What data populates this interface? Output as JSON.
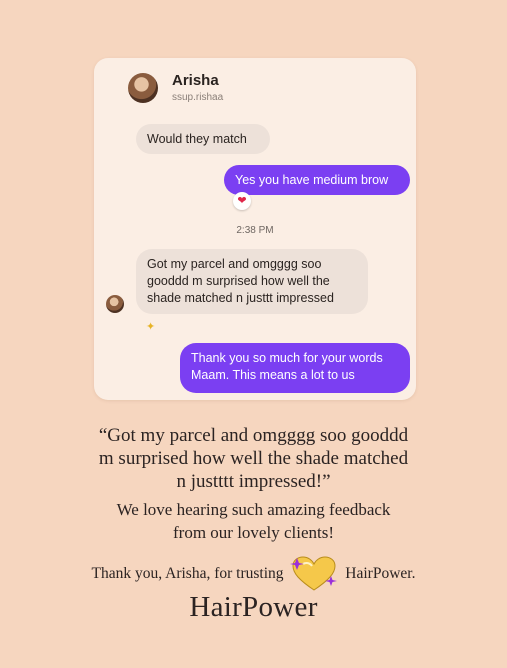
{
  "chat": {
    "contact_name": "Arisha",
    "contact_handle": "ssup.rishaa",
    "timestamp": "2:38 PM",
    "messages": [
      {
        "direction": "incoming",
        "text": "Would they match"
      },
      {
        "direction": "outgoing",
        "text": "Yes you have medium brow",
        "reaction": "heart"
      },
      {
        "direction": "incoming",
        "lines": [
          "Got my parcel and omgggg soo",
          "gooddd m surprised how well the",
          "shade matched n justtt impressed"
        ]
      },
      {
        "direction": "outgoing",
        "lines": [
          "Thank you so much for your words",
          "Maam. This means a lot to us"
        ]
      }
    ]
  },
  "caption": {
    "quote_lines": [
      "“Got my parcel and omgggg soo gooddd",
      "m surprised how well the shade matched",
      "n justttt impressed!”"
    ],
    "body_lines": [
      "We love hearing such amazing feedback",
      "from our lovely clients!"
    ],
    "thanks_before": "Thank you, Arisha, for trusting",
    "thanks_after": "HairPower.",
    "brand": "HairPower"
  },
  "colors": {
    "background": "#f6d6bf",
    "outgoing_bubble": "#7b3ff2",
    "incoming_bubble": "#ede1d9",
    "text": "#2b2322"
  },
  "icons": {
    "reaction": "heart-icon",
    "sparkle": "sparkle-icon",
    "logo": "hairpower-heart-logo-icon"
  }
}
